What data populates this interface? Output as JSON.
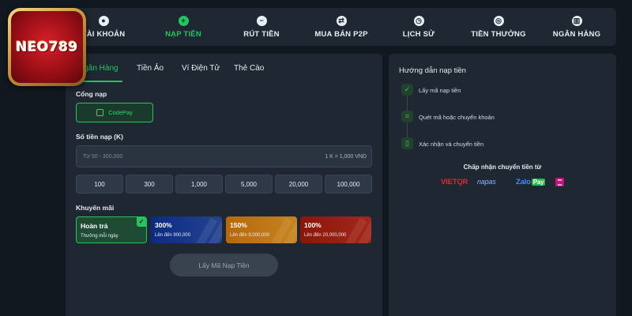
{
  "brand": {
    "logo_text": "NEO789"
  },
  "nav": {
    "items": [
      {
        "label": "TÀI KHOẢN",
        "icon": "account-icon",
        "glyph": "●"
      },
      {
        "label": "NẠP TIỀN",
        "icon": "deposit-icon",
        "glyph": "+"
      },
      {
        "label": "RÚT TIỀN",
        "icon": "withdraw-icon",
        "glyph": "−"
      },
      {
        "label": "MUA BÁN P2P",
        "icon": "p2p-icon",
        "glyph": "⇄"
      },
      {
        "label": "LỊCH SỬ",
        "icon": "history-icon",
        "glyph": "◷"
      },
      {
        "label": "TIỀN THƯỞNG",
        "icon": "reward-icon",
        "glyph": "◎"
      },
      {
        "label": "NGÂN HÀNG",
        "icon": "bank-icon",
        "glyph": "▥"
      }
    ],
    "active_index": 1
  },
  "deposit": {
    "tabs": [
      "Ngân Hàng",
      "Tiền Ảo",
      "Ví Điện Tử",
      "Thẻ Cào"
    ],
    "gate_label": "Cổng nạp",
    "gate_button": "CodePay",
    "amount_label": "Số tiền nạp (K)",
    "amount_placeholder": "Từ 50 - 300,000",
    "amount_rate": "1 K = 1,000 VND",
    "amount_options": [
      "100",
      "300",
      "1,000",
      "5,000",
      "20,000",
      "100,000"
    ],
    "promo_label": "Khuyến mãi",
    "promos": [
      {
        "title": "Hoàn trả",
        "subtitle": "Thưởng mỗi ngày",
        "selected": true
      },
      {
        "title": "300%",
        "subtitle": "Lên đến 900,000",
        "selected": false
      },
      {
        "title": "150%",
        "subtitle": "Lên đến 9,000,000",
        "selected": false
      },
      {
        "title": "100%",
        "subtitle": "Lên đến 20,000,000",
        "selected": false
      }
    ],
    "submit_label": "Lấy Mã Nạp Tiền"
  },
  "guide": {
    "title": "Hướng dẫn nạp tiền",
    "steps": [
      "Lấy mã nạp tiền",
      "Quét mã hoặc chuyển khoản",
      "Xác nhận và chuyển tiền"
    ],
    "accept_title": "Chấp nhận chuyển tiền từ",
    "partners": {
      "vietqr": "VIETQR",
      "napas": "napas",
      "zalo": "Zalo",
      "zalo_pay": "Pay",
      "momo": "mo mo"
    }
  },
  "colors": {
    "accent": "#22c55e",
    "panel": "#1e2732",
    "background": "#111820"
  }
}
